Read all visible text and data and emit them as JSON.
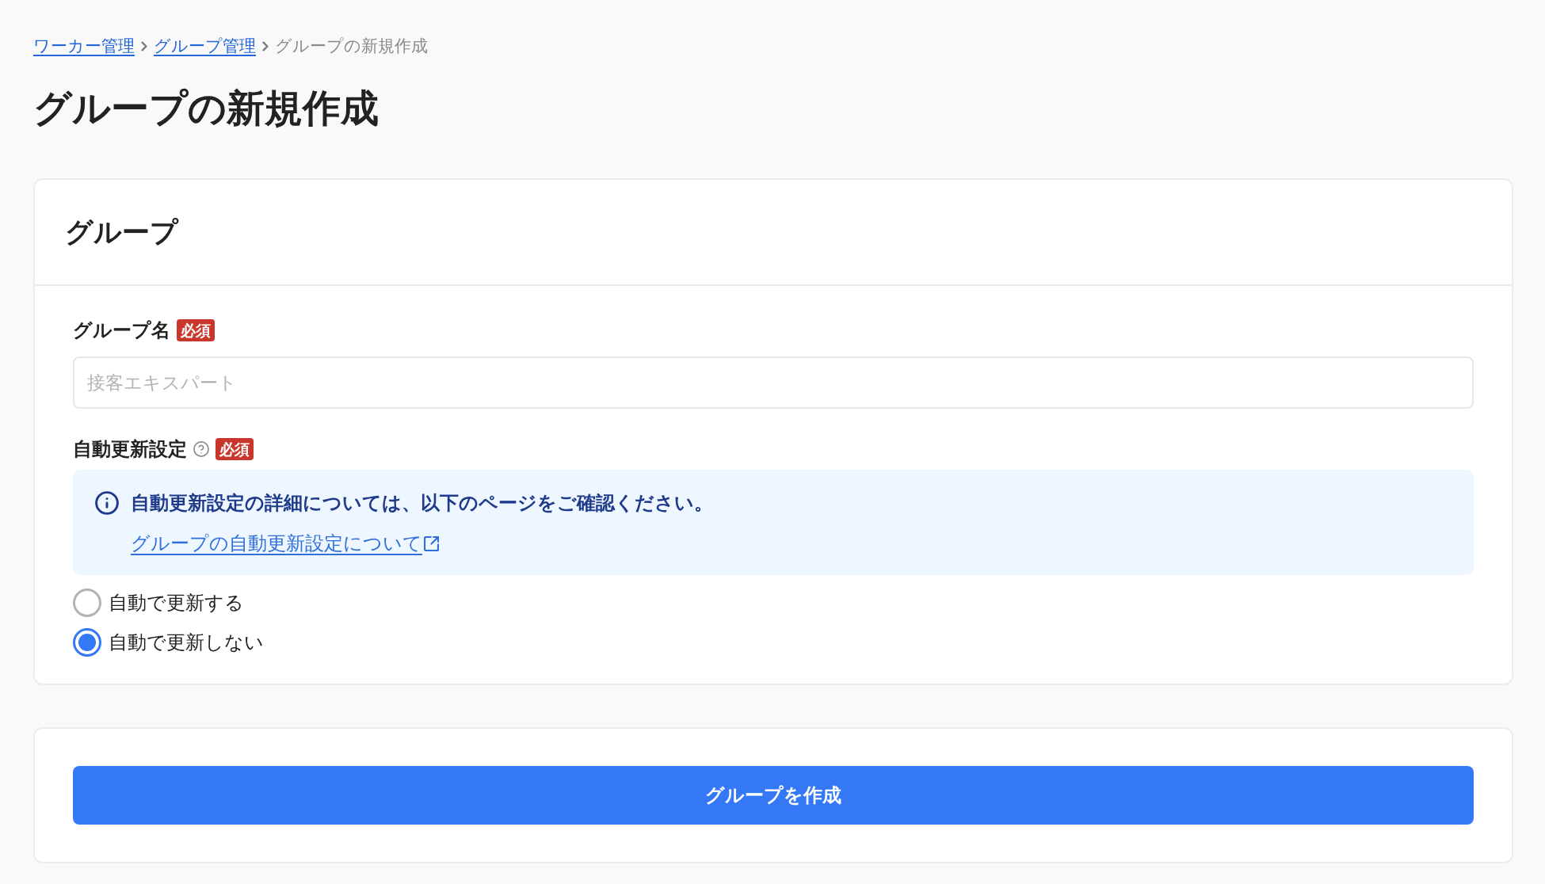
{
  "breadcrumb": [
    {
      "label": "ワーカー管理",
      "kind": "link"
    },
    {
      "label": "グループ管理",
      "kind": "link"
    },
    {
      "label": "グループの新規作成",
      "kind": "current"
    }
  ],
  "page_title": "グループの新規作成",
  "form_card": {
    "title": "グループ",
    "fields": [
      {
        "kind": "text",
        "label": "グループ名",
        "help": false,
        "required_badge": "必須",
        "placeholder": "接客エキスパート"
      },
      {
        "kind": "radio",
        "label": "自動更新設定",
        "help": true,
        "required_badge": "必須",
        "notice": {
          "message": "自動更新設定の詳細については、以下のページをご確認ください。",
          "link": "グループの自動更新設定について"
        },
        "options": [
          {
            "label": "自動で更新する",
            "selected": false
          },
          {
            "label": "自動で更新しない",
            "selected": true
          }
        ]
      }
    ]
  },
  "submit_button": "グループを作成"
}
